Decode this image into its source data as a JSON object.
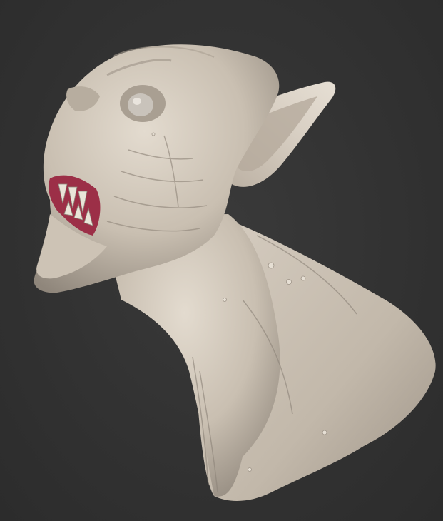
{
  "scene": {
    "subject": "",
    "background_color": "#333333",
    "material_colors": {
      "skin_light": "#ddd4c8",
      "skin_mid": "#bdb2a4",
      "skin_shadow": "#8f867b",
      "lips": "#9c2f47",
      "teeth": "#e9e4d8"
    }
  }
}
